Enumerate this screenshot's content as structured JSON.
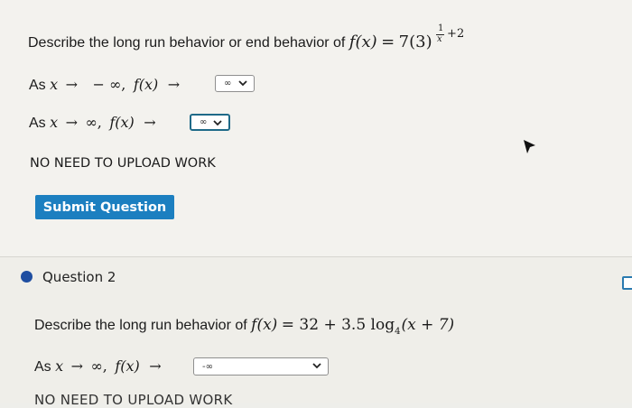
{
  "question1": {
    "prompt_text": "Describe the long run behavior or end behavior of",
    "function_lhs": "f(x)",
    "function_eq": "=",
    "function_base": "7(3)",
    "exponent_num": "1",
    "exponent_den": "x",
    "exponent_tail": "+2",
    "row1": {
      "lead": "As",
      "var": "x",
      "arrow1": "→",
      "limit": "− ∞,",
      "fx": "f(x)",
      "arrow2": "→",
      "selected": "∞"
    },
    "row2": {
      "lead": "As",
      "var": "x",
      "arrow1": "→",
      "limit": "∞,",
      "fx": "f(x)",
      "arrow2": "→",
      "selected": "∞"
    },
    "note": "NO NEED TO UPLOAD WORK",
    "submit_label": "Submit Question"
  },
  "question2": {
    "title": "Question 2",
    "prompt_text": "Describe the long run behavior of",
    "function_lhs": "f(x)",
    "function_rhs": "= 32 + 3.5 log",
    "log_base": "4",
    "function_arg": "(x + 7)",
    "row1": {
      "lead": "As",
      "var": "x",
      "arrow1": "→",
      "limit": "∞,",
      "fx": "f(x)",
      "arrow2": "→",
      "selected": "-∞"
    },
    "note_partial": "NO NEED TO UPLOAD WORK"
  },
  "icons": {
    "bullet": "blue-bullet-icon",
    "dropdown": "chevron-down-icon",
    "corner": "collapse-toggle-icon",
    "cursor": "mouse-pointer-icon"
  },
  "colors": {
    "submit_bg": "#1c7fc0",
    "bullet": "#1f4ea1",
    "focus_border": "#1f6a88"
  }
}
